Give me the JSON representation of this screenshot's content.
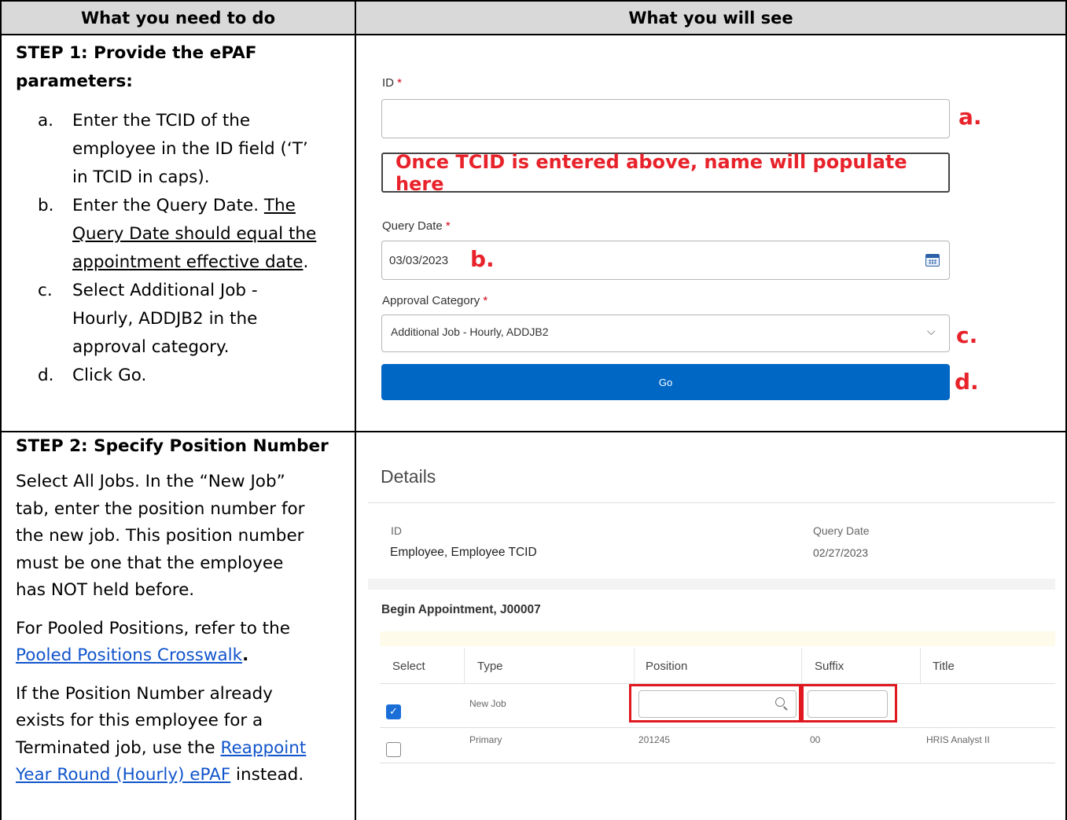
{
  "header": {
    "left": "What you need to do",
    "right": "What you will see"
  },
  "step1": {
    "title_line1": "STEP 1: Provide the ePAF",
    "title_line2": "parameters:",
    "items": [
      {
        "marker": "a.",
        "lines": [
          "Enter the TCID of the",
          "employee in the ID field (‘T’",
          "in TCID in caps)."
        ]
      },
      {
        "marker": "b.",
        "line1": "Enter the Query Date. ",
        "line1_u": "The",
        "u_lines": [
          "Query Date should equal the",
          "appointment effective date"
        ],
        "u_tail": "."
      },
      {
        "marker": "c.",
        "lines": [
          "Select Additional Job -",
          "Hourly, ADDJB2 in the",
          "approval category."
        ]
      },
      {
        "marker": "d.",
        "lines": [
          "Click Go."
        ]
      }
    ],
    "form": {
      "id_label": "ID",
      "required_mark": "*",
      "notice": "Once TCID is entered above, name will populate here",
      "query_date_label": "Query Date",
      "query_date_value": "03/03/2023",
      "approval_label": "Approval Category",
      "approval_value": "Additional Job - Hourly, ADDJB2",
      "go_label": "Go",
      "callouts": {
        "a": "a.",
        "b": "b.",
        "c": "c.",
        "d": "d."
      }
    }
  },
  "step2": {
    "title": "STEP 2: Specify Position Number",
    "para1": [
      "Select All Jobs. In the “New Job”",
      "tab, enter the position number for",
      "the new job. This position number",
      "must be one that the employee",
      "has NOT held before."
    ],
    "para2_line1": "For Pooled Positions, refer to the",
    "para2_link": "Pooled Positions Crosswalk",
    "para2_tail": ".",
    "para3": [
      "If the Position Number already",
      "exists for this employee for a"
    ],
    "para3_line3": "Terminated job, use the ",
    "para3_link1": "Reappoint",
    "para3_link2": "Year Round (Hourly) ePAF",
    "para3_tail": " instead.",
    "screen": {
      "details_title": "Details",
      "id_label": "ID",
      "id_value": "Employee, Employee TCID",
      "query_date_label": "Query Date",
      "query_date_value": "02/27/2023",
      "appointment": "Begin Appointment, J00007",
      "columns": [
        "Select",
        "Type",
        "Position",
        "Suffix",
        "Title"
      ],
      "rows": [
        {
          "selected": true,
          "type": "New Job",
          "position": "",
          "suffix": "",
          "title": ""
        },
        {
          "selected": false,
          "type": "Primary",
          "position": "201245",
          "suffix": "00",
          "title": "HRIS Analyst II"
        }
      ]
    }
  }
}
